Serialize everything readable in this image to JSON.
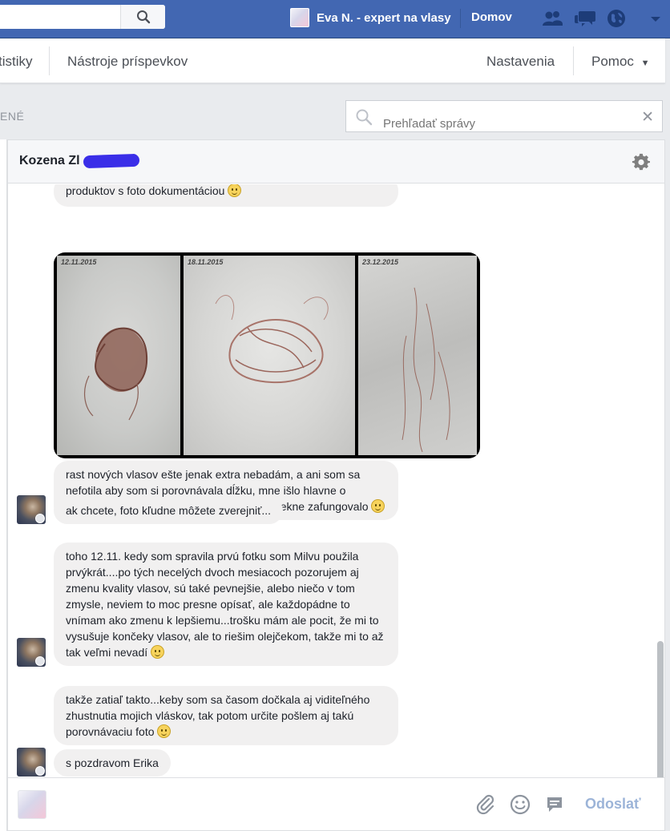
{
  "topbar": {
    "profile_name": "Eva N. - expert na vlasy",
    "home_label": "Domov"
  },
  "pagenav": {
    "stats_partial": "tistiky",
    "post_tools": "Nástroje príspevkov",
    "settings": "Nastavenia",
    "help": "Pomoc"
  },
  "inbox": {
    "filter_partial": "ENÉ",
    "search_placeholder": "Prehľadať správy"
  },
  "chat": {
    "contact_name": "Kozena Zl",
    "photo_dates": [
      "12.11.2015",
      "18.11.2015",
      "23.12.2015"
    ],
    "messages": [
      {
        "text": "produktov s foto dokumentáciou",
        "emoji": true
      },
      {
        "text": "rast nových vlasov ešte jenak extra nebadám, a ani som sa nefotila aby som si porovnávala dĺžku, mne išlo hlavne o zastavenie toho vypadávania a to celkom pekne zafungovalo",
        "emoji": true
      },
      {
        "text": "ak chcete, foto kľudne môžete zverejniť...",
        "emoji": false
      },
      {
        "text": "toho 12.11. kedy som spravila prvú fotku som Milvu použila prvýkrát....po tých necelých dvoch mesiacoch pozorujem aj zmenu kvality vlasov, sú také pevnejšie, alebo niečo v tom zmysle, neviem to moc presne opísať, ale každopádne to vnímam ako zmenu k lepšiemu...trošku mám ale pocit, že mi to vysušuje končeky vlasov, ale to riešim olejčekom, takže mi to až tak veľmi nevadí",
        "emoji": true
      },
      {
        "text": "takže zatiaľ takto...keby som sa časom dočkala aj viditeľného zhustnutia mojich vláskov, tak potom určite pošlem aj takú porovnávaciu foto",
        "emoji": true
      },
      {
        "text": "s pozdravom Erika",
        "emoji": false
      }
    ]
  },
  "composer": {
    "send_label": "Odoslať"
  },
  "colors": {
    "brand": "#4267b2",
    "bubble": "#f1f0f0",
    "send_disabled": "#9cb4d8"
  }
}
